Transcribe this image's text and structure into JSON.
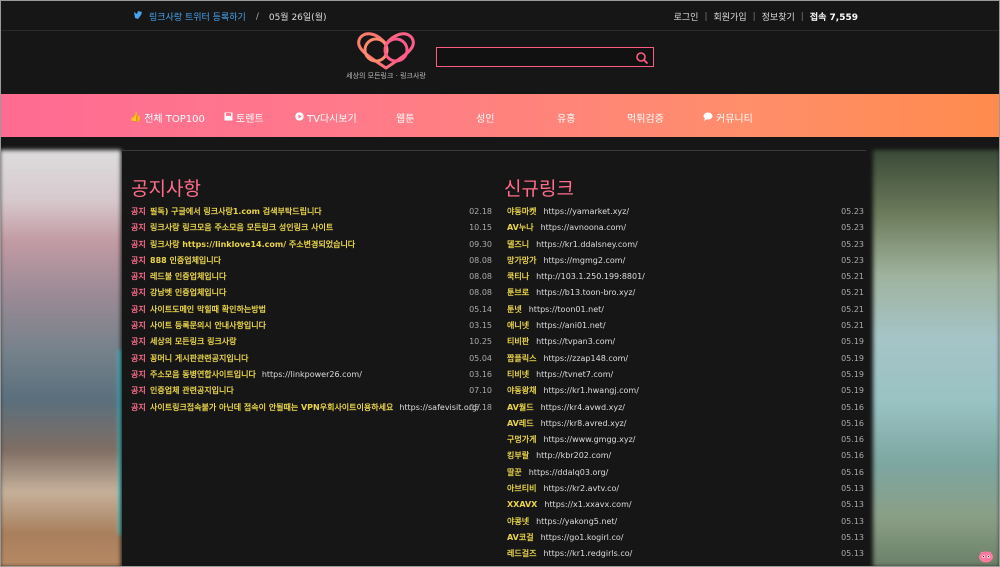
{
  "topbar": {
    "twitter_label": "링크사랑 트위터 등록하기",
    "date": "05월 26일(월)",
    "login": "로그인",
    "signup": "회원가입",
    "find_info": "정보찾기",
    "visitors": "접속 7,559"
  },
  "header": {
    "logo_text": "세상의 모든링크 · 링크사랑",
    "search_placeholder": ""
  },
  "nav": [
    {
      "label": "전체 TOP100",
      "icon": "thumbs-up-icon"
    },
    {
      "label": "토렌트",
      "icon": "save-icon"
    },
    {
      "label": "TV다시보기",
      "icon": "play-icon"
    },
    {
      "label": "웹툰",
      "icon": ""
    },
    {
      "label": "성인",
      "icon": ""
    },
    {
      "label": "유흥",
      "icon": ""
    },
    {
      "label": "먹튀검증",
      "icon": ""
    },
    {
      "label": "커뮤니티",
      "icon": "chat-icon"
    }
  ],
  "notices": {
    "title": "공지사항",
    "tag": "공지",
    "items": [
      {
        "text": "필독) 구글에서 링크사랑1.com 검색부탁드립니다",
        "url": "",
        "date": "02.18"
      },
      {
        "text": "링크사랑 링크모음 주소모음 모든링크 성인링크 사이트",
        "url": "",
        "date": "10.15"
      },
      {
        "text": "링크사랑 https://linklove14.com/ 주소변경되었습니다",
        "url": "",
        "date": "09.30"
      },
      {
        "text": "888 인증업체입니다",
        "url": "",
        "date": "08.08"
      },
      {
        "text": "레드불 인증업체입니다",
        "url": "",
        "date": "08.08"
      },
      {
        "text": "강남벳 인증업체입니다",
        "url": "",
        "date": "08.08"
      },
      {
        "text": "사이트도메인 막힐때 확인하는방법",
        "url": "",
        "date": "05.14"
      },
      {
        "text": "사이트 등록문의시 안내사항입니다",
        "url": "",
        "date": "03.15"
      },
      {
        "text": "세상의 모든링크 링크사랑",
        "url": "",
        "date": "10.25"
      },
      {
        "text": "꽁머니 게시판관련공지입니다",
        "url": "",
        "date": "05.04"
      },
      {
        "text": "주소모음 동병연합사이트입니다",
        "url": "https://linkpower26.com/",
        "date": "03.16"
      },
      {
        "text": "인증업체 관련공지입니다",
        "url": "",
        "date": "07.10"
      },
      {
        "text": "사이트링크접속불가 아닌데 접속이 안될때는 VPN우회사이트이용하세요",
        "url": "https://safevisit.org/",
        "date": "05.18"
      }
    ]
  },
  "new_links": {
    "title": "신규링크",
    "items": [
      {
        "name": "야동마켓",
        "url": "https://yamarket.xyz/",
        "date": "05.23"
      },
      {
        "name": "AV누나",
        "url": "https://avnoona.com/",
        "date": "05.23"
      },
      {
        "name": "델즈니",
        "url": "https://kr1.ddalsney.com/",
        "date": "05.23"
      },
      {
        "name": "망가망가",
        "url": "https://mgmg2.com/",
        "date": "05.23"
      },
      {
        "name": "쿡티나",
        "url": "http://103.1.250.199:8801/",
        "date": "05.21"
      },
      {
        "name": "툰브로",
        "url": "https://b13.toon-bro.xyz/",
        "date": "05.21"
      },
      {
        "name": "툰넷",
        "url": "https://toon01.net/",
        "date": "05.21"
      },
      {
        "name": "애니넷",
        "url": "https://ani01.net/",
        "date": "05.21"
      },
      {
        "name": "티비판",
        "url": "https://tvpan3.com/",
        "date": "05.19"
      },
      {
        "name": "짭플릭스",
        "url": "https://zzap148.com/",
        "date": "05.19"
      },
      {
        "name": "티비넷",
        "url": "https://tvnet7.com/",
        "date": "05.19"
      },
      {
        "name": "야동왕채",
        "url": "https://kr1.hwangj.com/",
        "date": "05.19"
      },
      {
        "name": "AV월드",
        "url": "https://kr4.avwd.xyz/",
        "date": "05.16"
      },
      {
        "name": "AV레드",
        "url": "https://kr8.avred.xyz/",
        "date": "05.16"
      },
      {
        "name": "구멍가게",
        "url": "https://www.gmgg.xyz/",
        "date": "05.16"
      },
      {
        "name": "킹부랄",
        "url": "http://kbr202.com/",
        "date": "05.16"
      },
      {
        "name": "딸꾼",
        "url": "https://ddalq03.org/",
        "date": "05.16"
      },
      {
        "name": "아브티비",
        "url": "https://kr2.avtv.co/",
        "date": "05.13"
      },
      {
        "name": "XXAVX",
        "url": "https://x1.xxavx.com/",
        "date": "05.13"
      },
      {
        "name": "야콩넷",
        "url": "https://yakong5.net/",
        "date": "05.13"
      },
      {
        "name": "AV코걸",
        "url": "https://go1.kogirl.co/",
        "date": "05.13"
      },
      {
        "name": "레드걸즈",
        "url": "https://kr1.redgirls.co/",
        "date": "05.13"
      }
    ]
  },
  "colors": {
    "accent": "#ff6d8a",
    "link_name": "#e8d44a",
    "nav_gradient_start": "#ff6b93",
    "nav_gradient_end": "#ff8b4d"
  }
}
